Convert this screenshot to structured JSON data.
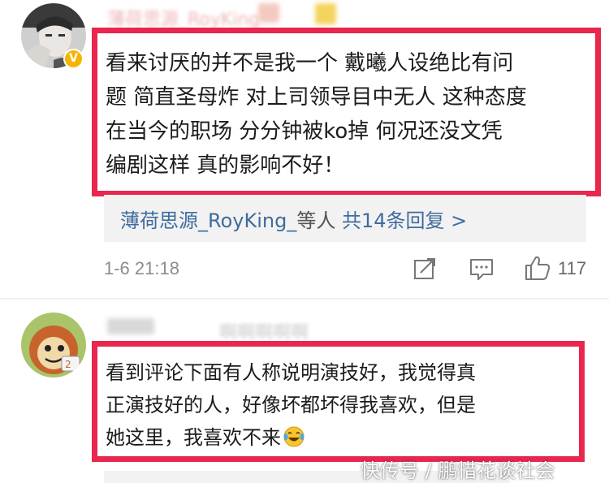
{
  "comments": [
    {
      "username": "薄荷思源_RoyKing",
      "lines": [
        "看来讨厌的并不是我一个 戴曦人设绝比有问",
        "题 简直圣母炸 对上司领导目中无人 这种态度",
        "在当今的职场 分分钟被ko掉 何况还没文凭",
        "编剧这样 真的影响不好！"
      ],
      "verified_badge": "V",
      "reply_preview": {
        "name": "薄荷思源_RoyKing_",
        "middle": "等人",
        "count_text": "共14条回复 >"
      },
      "timestamp": "1-6 21:18",
      "likes": "117",
      "icons": [
        "share-icon",
        "comment-icon",
        "like-icon"
      ]
    },
    {
      "username": "啊啊啊啊啊",
      "lines": [
        "看到评论下面有人称说明演技好，我觉得真",
        "正演技好的人，好像坏都坏得我喜欢，但是",
        "她这里，我喜欢不来"
      ],
      "emoji": "laugh-cry-emoji"
    }
  ],
  "watermark": "快传号 / 鹏惜花谈社会",
  "colors": {
    "highlight_border": "#e8264e",
    "link": "#3f6c9e",
    "reply_bg": "#f2f2f2",
    "badge": "#f5b400"
  }
}
